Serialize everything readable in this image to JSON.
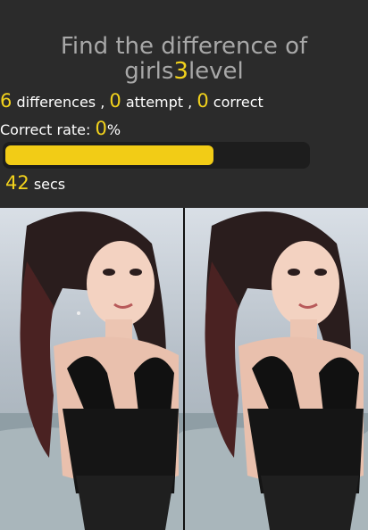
{
  "header": {
    "title_line1": "Find the difference of",
    "title_prefix": "girls",
    "title_level": "3",
    "title_suffix": "level"
  },
  "stats": {
    "differences_count": "6",
    "differences_label": " differences , ",
    "attempt_count": "0",
    "attempt_label": " attempt , ",
    "correct_count": "0",
    "correct_label": " correct"
  },
  "rate": {
    "label": "Correct rate: ",
    "value": "0",
    "unit": "%"
  },
  "progress": {
    "fraction": 0.69,
    "color": "#f2cc16"
  },
  "timer": {
    "value": "42",
    "unit": " secs"
  },
  "images": {
    "left": "photo-left",
    "right": "photo-right"
  }
}
